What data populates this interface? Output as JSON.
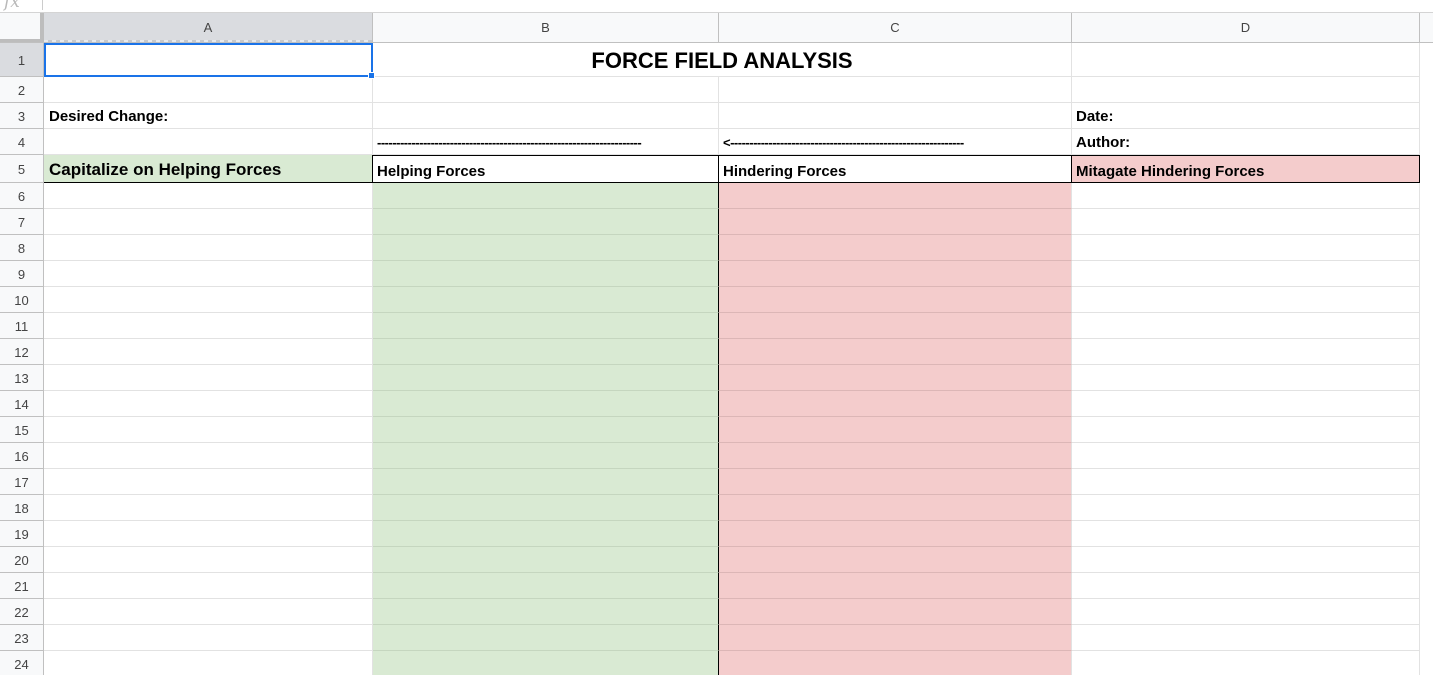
{
  "formula_bar": {
    "fx_label": "fx",
    "value": ""
  },
  "columns": [
    "A",
    "B",
    "C",
    "D"
  ],
  "rows": [
    "1",
    "2",
    "3",
    "4",
    "5",
    "6",
    "7",
    "8",
    "9",
    "10",
    "11",
    "12",
    "13",
    "14",
    "15",
    "16",
    "17",
    "18",
    "19",
    "20",
    "21",
    "22",
    "23",
    "24"
  ],
  "selected_cell": "A1",
  "sheet": {
    "title": "FORCE FIELD ANALYSIS",
    "desired_change_label": "Desired Change:",
    "date_label": "Date:",
    "author_label": "Author:",
    "arrow_left_part": "---------------------------------------------------------------------",
    "arrow_right_part": "<-------------------------------------------------------------",
    "headers": {
      "a": "Capitalize on Helping Forces",
      "b": "Helping Forces",
      "c": "Hindering Forces",
      "d": "Mitagate Hindering Forces"
    }
  },
  "colors": {
    "helping": "#d9ead3",
    "hindering": "#f4cccc",
    "selection": "#1a73e8"
  }
}
